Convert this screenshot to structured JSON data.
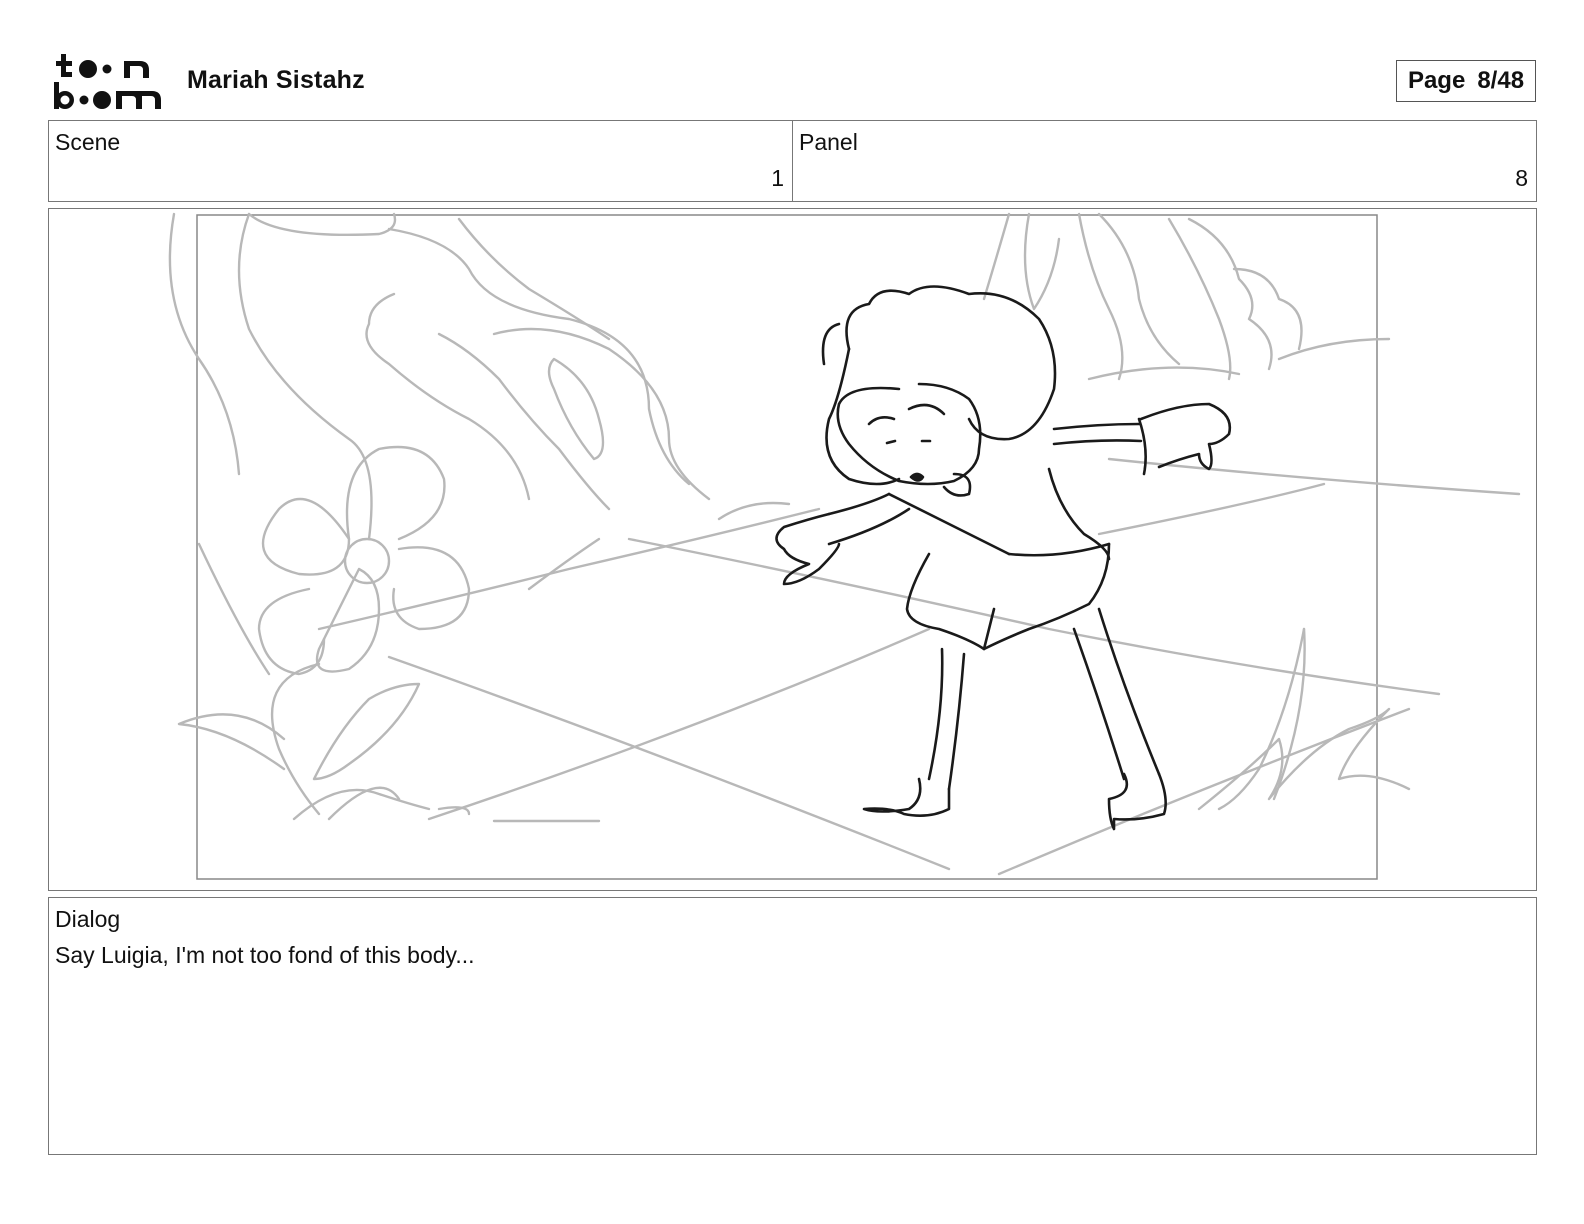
{
  "header": {
    "logo_text_top": "toon",
    "logo_text_bottom": "boom",
    "project_title": "Mariah Sistahz",
    "page_label": "Page",
    "page_value": "8/48"
  },
  "info": {
    "scene_label": "Scene",
    "scene_value": "1",
    "panel_label": "Panel",
    "panel_value": "8"
  },
  "dialog": {
    "label": "Dialog",
    "text": "Say Luigia, I'm not too fond of this body..."
  },
  "colors": {
    "border": "#777777",
    "sketch_dark": "#1a1a1a",
    "sketch_light": "#b5b5b5"
  }
}
